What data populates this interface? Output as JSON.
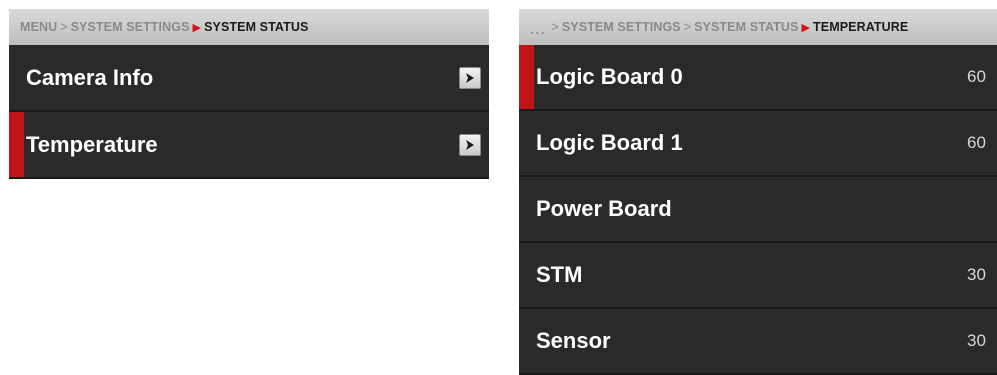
{
  "left": {
    "breadcrumb": {
      "items": [
        "MENU",
        "SYSTEM SETTINGS"
      ],
      "separator": ">",
      "current": "SYSTEM STATUS"
    },
    "rows": [
      {
        "label": "Camera Info"
      },
      {
        "label": "Temperature"
      }
    ]
  },
  "right": {
    "breadcrumb": {
      "ellipsis": "...",
      "items": [
        "SYSTEM SETTINGS",
        "SYSTEM STATUS"
      ],
      "separator": ">",
      "current": "TEMPERATURE"
    },
    "rows": [
      {
        "label": "Logic Board 0",
        "value": "60"
      },
      {
        "label": "Logic Board 1",
        "value": "60"
      },
      {
        "label": "Power Board",
        "value": ""
      },
      {
        "label": "STM",
        "value": "30"
      },
      {
        "label": "Sensor",
        "value": "30"
      }
    ]
  },
  "colors": {
    "accent": "#c01418",
    "row_bg": "#2a2a2a",
    "crumb_bg": "#c8c8c8"
  },
  "icons": {
    "row_arrow": "chevron-right-icon"
  }
}
